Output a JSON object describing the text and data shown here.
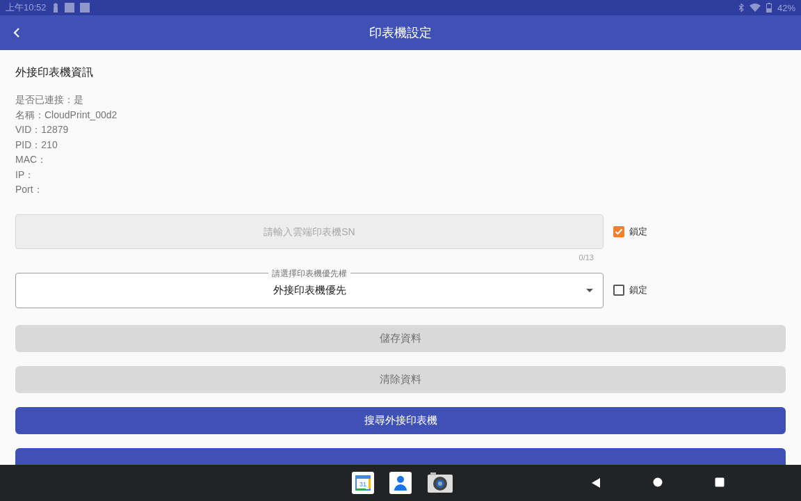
{
  "status_bar": {
    "time": "上午10:52",
    "battery": "42%"
  },
  "app_bar": {
    "title": "印表機設定"
  },
  "section_title": "外接印表機資訊",
  "info_lines": [
    "是否已連接：是",
    "名稱：CloudPrint_00d2",
    "VID：12879",
    "PID：210",
    "MAC：",
    "IP：",
    "Port："
  ],
  "sn_field": {
    "placeholder": "請輸入雲端印表機SN",
    "counter": "0/13",
    "disabled": true,
    "lock": {
      "label": "鎖定",
      "checked": true
    }
  },
  "priority_dropdown": {
    "label": "請選擇印表機優先權",
    "value": "外接印表機優先",
    "lock": {
      "label": "鎖定",
      "checked": false
    }
  },
  "buttons": [
    {
      "label": "儲存資料",
      "disabled": true
    },
    {
      "label": "清除資料",
      "disabled": true
    },
    {
      "label": "搜尋外接印表機",
      "disabled": false
    },
    {
      "disabled": false
    }
  ],
  "nav_bar": {
    "apps": [
      {
        "kind": "calendar",
        "label": "31"
      },
      {
        "kind": "contacts"
      },
      {
        "kind": "camera"
      }
    ]
  }
}
